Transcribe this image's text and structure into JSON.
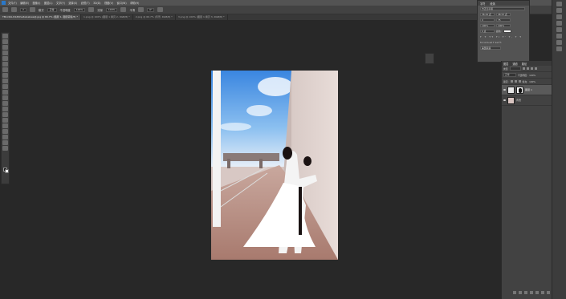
{
  "menu": {
    "items": [
      "文件(F)",
      "编辑(E)",
      "图像(I)",
      "图层(L)",
      "文字(Y)",
      "选择(S)",
      "滤镜(T)",
      "3D(D)",
      "视图(V)",
      "窗口(W)",
      "帮助(H)"
    ]
  },
  "options": {
    "size_value": "2",
    "mode_label": "模式",
    "mode_value": "正常",
    "opacity_label": "不透明度",
    "opacity_value": "100%",
    "flow_label": "流量",
    "flow_value": "100%",
    "smooth_label": "平滑",
    "angle_value": "0°"
  },
  "tabs": [
    {
      "label": "TB1c6AU21ZKhw6a1ebwa@.jpg @ 66.7% (图层 1, 图层蒙版/8) *",
      "active": true
    },
    {
      "label": "1.png @ 100% (图层 1 拷贝 2, RGB/8) *",
      "active": false
    },
    {
      "label": "2.png @ 66.7% (背景, RGB/8) *",
      "active": false
    },
    {
      "label": "3.png @ 100% (图层 1 拷贝 3, RGB/8) *",
      "active": false
    }
  ],
  "properties": {
    "tab_char": "字符",
    "tab_para": "段落",
    "font_value": "方正兰亭黑",
    "size_value": "36.44 点",
    "leading_value": "48.53 点",
    "tracking_value": "0",
    "kerning_value": "75",
    "scale_v": "100%",
    "scale_h": "100%",
    "baseline": "0 点",
    "color_label": "颜色:",
    "lang_value": "美国英语"
  },
  "layers": {
    "tab1": "图层",
    "tab2": "通道",
    "tab3": "路径",
    "kind_label": "类型",
    "blend_value": "正常",
    "opacity_label": "不透明度:",
    "opacity_value": "100%",
    "lock_label": "锁定:",
    "fill_label": "填充:",
    "fill_value": "100%",
    "items": [
      {
        "name": "图层 1",
        "selected": true,
        "has_mask": true
      },
      {
        "name": "背景",
        "selected": false,
        "has_mask": false
      }
    ]
  },
  "colors": {
    "sky": "#5f9ee0",
    "paving": "#b0887a",
    "wall": "#dcd0cc"
  }
}
